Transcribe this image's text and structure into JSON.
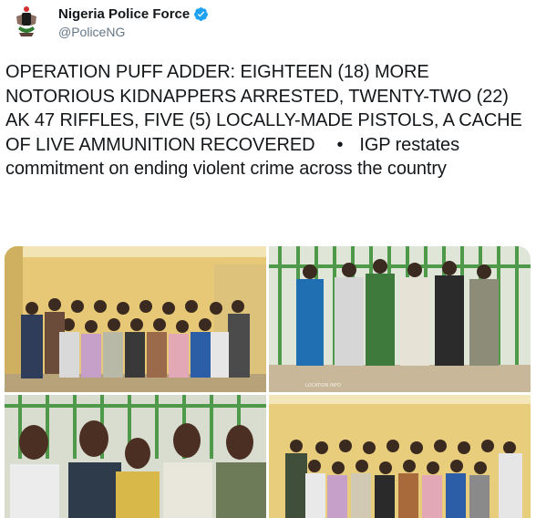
{
  "tweet": {
    "author_name": "Nigeria Police Force",
    "author_handle": "@PoliceNG",
    "verified_icon": "verified-badge-icon",
    "text_main": "OPERATION PUFF ADDER: EIGHTEEN (18) MORE NOTORIOUS KIDNAPPERS ARRESTED, TWENTY-TWO (22) AK 47 RIFFLES, FIVE (5) LOCALLY-MADE PISTOLS, A CACHE OF LIVE AMMUNITION RECOVERED",
    "bullet": "•",
    "text_secondary": "IGP restates commitment on ending violent crime across the country"
  },
  "media": {
    "photo_count": 4,
    "photo_2_caption": "LOCATION INFO"
  },
  "colors": {
    "verified_blue": "#1da1f2",
    "handle_gray": "#657786",
    "text_dark": "#14171a"
  }
}
